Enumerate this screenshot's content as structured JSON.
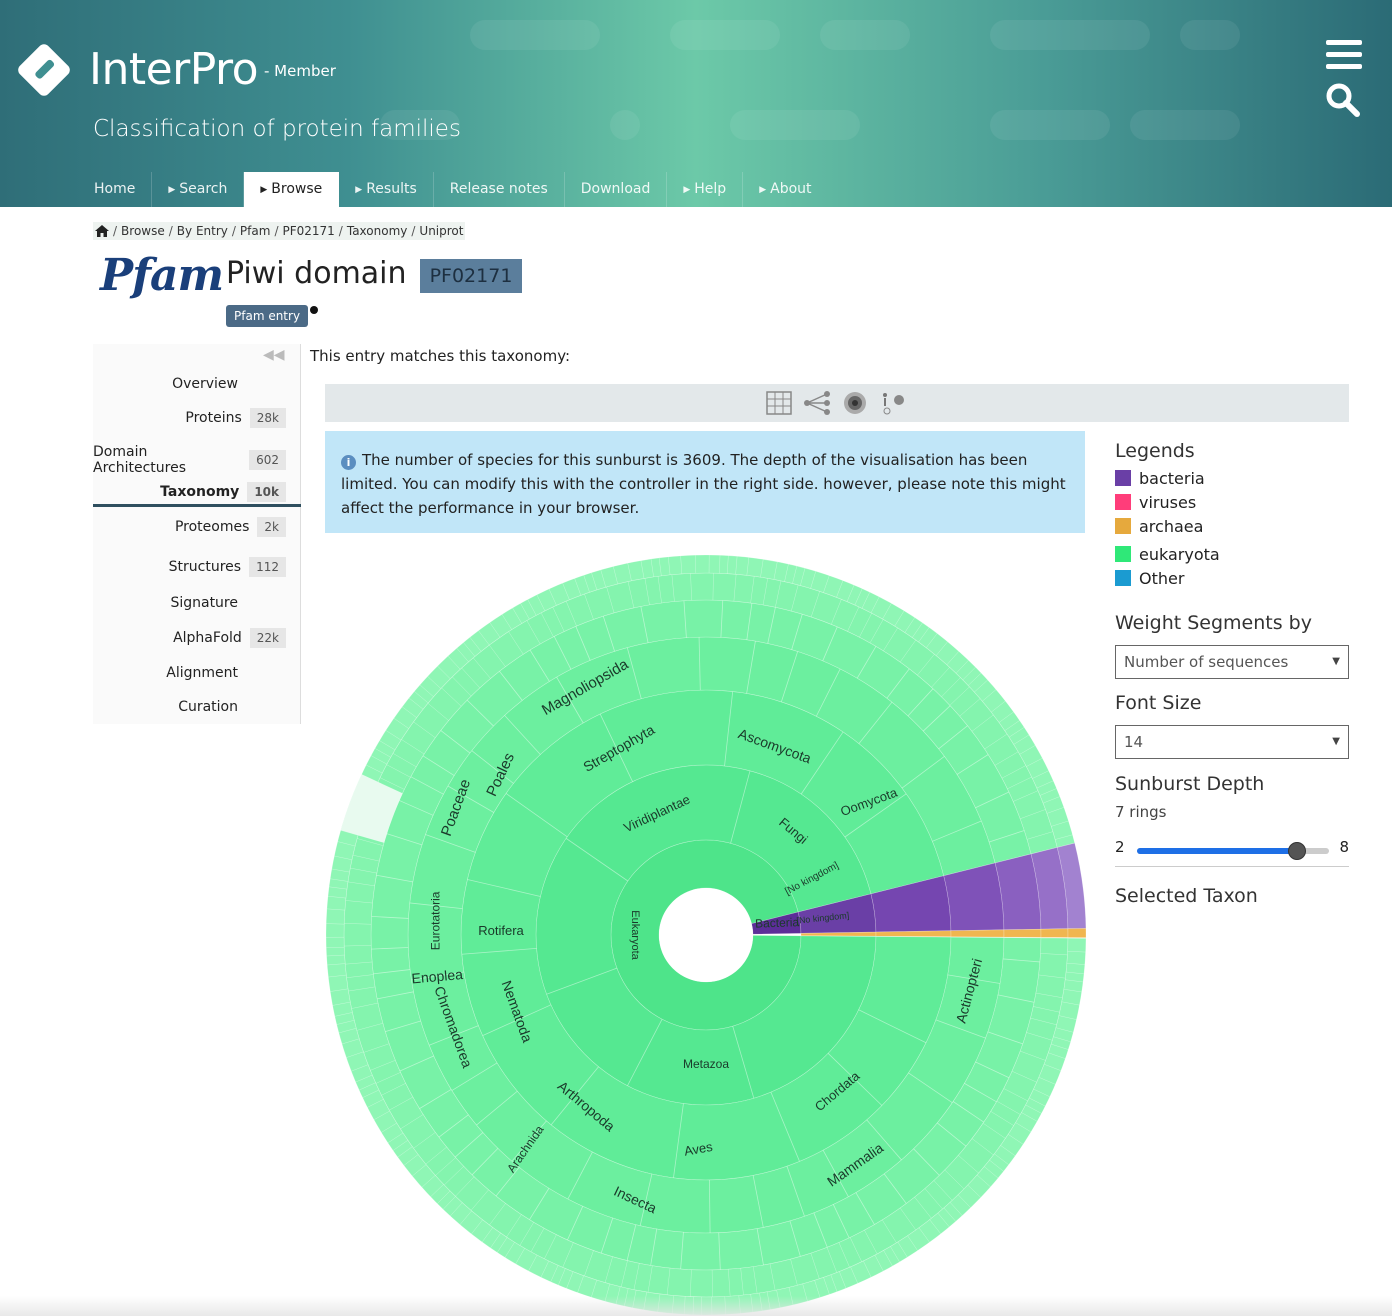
{
  "header": {
    "brand": "InterPro",
    "brand_sub": "- Member",
    "tagline": "Classification of protein families",
    "nav": [
      {
        "label": "Home",
        "caret": false,
        "active": false
      },
      {
        "label": "Search",
        "caret": true,
        "active": false
      },
      {
        "label": "Browse",
        "caret": true,
        "active": true
      },
      {
        "label": "Results",
        "caret": true,
        "active": false
      },
      {
        "label": "Release notes",
        "caret": false,
        "active": false
      },
      {
        "label": "Download",
        "caret": false,
        "active": false
      },
      {
        "label": "Help",
        "caret": true,
        "active": false
      },
      {
        "label": "About",
        "caret": true,
        "active": false
      }
    ]
  },
  "breadcrumb": [
    "Browse",
    "By Entry",
    "Pfam",
    "PF02171",
    "Taxonomy",
    "Uniprot"
  ],
  "entry": {
    "db_logo": "Pfam",
    "title": "Piwi domain",
    "accession": "PF02171",
    "type": "Pfam entry"
  },
  "sidebar": {
    "items": [
      {
        "label": "Overview",
        "count": ""
      },
      {
        "label": "Proteins",
        "count": "28k"
      },
      {
        "label": "Domain Architectures",
        "count": "602"
      },
      {
        "label": "Taxonomy",
        "count": "10k"
      },
      {
        "label": "Proteomes",
        "count": "2k"
      },
      {
        "label": "Structures",
        "count": "112"
      },
      {
        "label": "Signature",
        "count": ""
      },
      {
        "label": "AlphaFold",
        "count": "22k"
      },
      {
        "label": "Alignment",
        "count": ""
      },
      {
        "label": "Curation",
        "count": ""
      }
    ],
    "active": "Taxonomy"
  },
  "main": {
    "intro": "This entry matches this taxonomy:",
    "toolbar_icons": [
      "table-icon",
      "tree-icon",
      "sunburst-icon",
      "species-icon"
    ],
    "callout": "The number of species for this sunburst is 3609. The depth of the visualisation has been limited. You can modify this with the controller in the right side. however, please note this might affect the performance in your browser."
  },
  "sunburst_labels": {
    "center": [
      "Eukaryota",
      "Bacteria"
    ],
    "ring1": [
      "Viridiplantae",
      "Fungi",
      "Metazoa",
      "[No kingdom]",
      "[No kingdom]"
    ],
    "ring2": [
      "Streptophyta",
      "Ascomycota",
      "Chordata",
      "Arthropoda",
      "Nematoda",
      "Rotifera",
      "Oomycota"
    ],
    "ring3": [
      "Magnoliopsida",
      "Poales",
      "Poaceae",
      "Actinopteri",
      "Mammalia",
      "Aves",
      "Insecta",
      "Chromadorea",
      "Enoplea",
      "Eurotatoria",
      "Arachnida"
    ]
  },
  "panel": {
    "legends_title": "Legends",
    "legends": [
      {
        "label": "bacteria",
        "color": "#6a3fa6"
      },
      {
        "label": "viruses",
        "color": "#ff3d7a"
      },
      {
        "label": "archaea",
        "color": "#e6a93d"
      },
      {
        "label": "eukaryota",
        "color": "#2fe878"
      },
      {
        "label": "Other",
        "color": "#1b9bd1"
      }
    ],
    "weight_title": "Weight Segments by",
    "weight_value": "Number of sequences",
    "font_title": "Font Size",
    "font_value": "14",
    "depth_title": "Sunburst Depth",
    "depth_value": "7 rings",
    "depth_min": "2",
    "depth_max": "8",
    "depth_level": 7,
    "selected_title": "Selected Taxon"
  }
}
